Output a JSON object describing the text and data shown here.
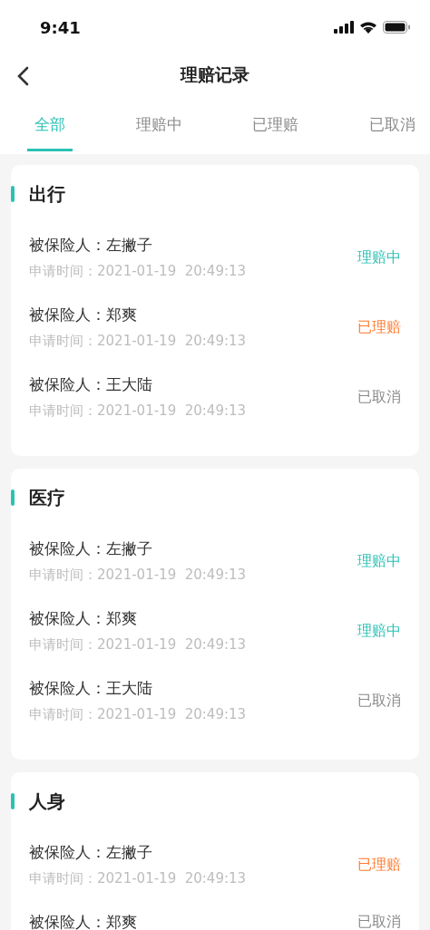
{
  "status_bar": {
    "time": "9:41"
  },
  "nav": {
    "title": "理赔记录"
  },
  "tabs": [
    {
      "label": "全部",
      "selected": true
    },
    {
      "label": "理赔中",
      "selected": false
    },
    {
      "label": "已理赔",
      "selected": false
    },
    {
      "label": "已取消",
      "selected": false
    }
  ],
  "groups": [
    {
      "title": "出行",
      "claims": [
        {
          "insured": "被保险人：左撇子",
          "time": "申请时间：2021-01-19  20:49:13",
          "status": "理赔中",
          "kind": "processing"
        },
        {
          "insured": "被保险人：郑爽",
          "time": "申请时间：2021-01-19  20:49:13",
          "status": "已理赔",
          "kind": "paid"
        },
        {
          "insured": "被保险人：王大陆",
          "time": "申请时间：2021-01-19  20:49:13",
          "status": "已取消",
          "kind": "cancelled"
        }
      ]
    },
    {
      "title": "医疗",
      "claims": [
        {
          "insured": "被保险人：左撇子",
          "time": "申请时间：2021-01-19  20:49:13",
          "status": "理赔中",
          "kind": "processing"
        },
        {
          "insured": "被保险人：郑爽",
          "time": "申请时间：2021-01-19  20:49:13",
          "status": "理赔中",
          "kind": "processing"
        },
        {
          "insured": "被保险人：王大陆",
          "time": "申请时间：2021-01-19  20:49:13",
          "status": "已取消",
          "kind": "cancelled"
        }
      ]
    },
    {
      "title": "人身",
      "claims": [
        {
          "insured": "被保险人：左撇子",
          "time": "申请时间：2021-01-19  20:49:13",
          "status": "已理赔",
          "kind": "paid"
        },
        {
          "insured": "被保险人：郑爽",
          "status": "已取消",
          "kind": "cancelled"
        }
      ]
    }
  ]
}
